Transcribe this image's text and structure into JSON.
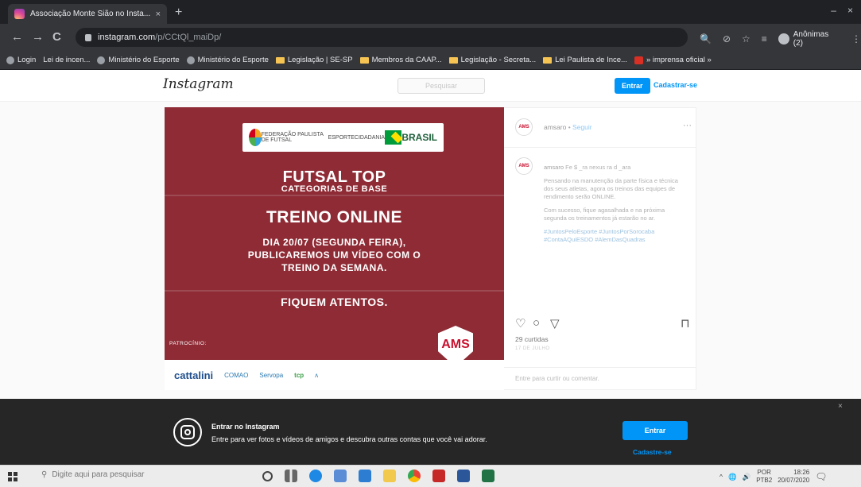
{
  "browser": {
    "tab_title": "Associação Monte Sião no Insta...",
    "tab_close": "×",
    "new_tab": "+",
    "window_controls": [
      "–",
      "×"
    ],
    "back": "←",
    "forward": "→",
    "reload": "C",
    "url_host": "instagram.com",
    "url_path": "/p/CCtQl_maiDp/",
    "toolbar_icons": [
      "🔍",
      "⊘",
      "☆",
      "≡"
    ],
    "profile_label": "Anônimas (2)",
    "menu": "⋮",
    "bookmarks": [
      {
        "icon": "globe",
        "label": "Login"
      },
      {
        "icon": "none",
        "label": "Lei de incen..."
      },
      {
        "icon": "globe",
        "label": "Ministério do Esporte"
      },
      {
        "icon": "globe",
        "label": "Ministério do Esporte"
      },
      {
        "icon": "folder",
        "label": "Legislação | SE-SP"
      },
      {
        "icon": "folder",
        "label": "Membros da CAAP..."
      },
      {
        "icon": "folder",
        "label": "Legislação - Secreta..."
      },
      {
        "icon": "folder",
        "label": "Lei Paulista de Ince..."
      },
      {
        "icon": "red",
        "label": "» imprensa oficial »"
      }
    ]
  },
  "ig_header": {
    "logo": "Instagram",
    "search_placeholder": "Pesquisar",
    "login_button": "Entrar",
    "signup_link": "Cadastrar-se"
  },
  "post": {
    "sponsor_top_left": "FEDERAÇÃO PAULISTA DE FUTSAL",
    "sponsor_top_mid1": "ESPORTE",
    "sponsor_top_mid2": "CIDADANIA",
    "sponsor_top_brand": "BRASIL",
    "title": "FUTSAL TOP",
    "subtitle": "CATEGORIAS DE BASE",
    "headline": "TREINO ONLINE",
    "body": "DIA 20/07 (SEGUNDA FEIRA), PUBLICAREMOS UM VÍDEO COM O TREINO DA SEMANA.",
    "closing": "FIQUEM ATENTOS.",
    "patrocinio": "PATROCÍNIO:",
    "badge": "AMS",
    "sponsors": [
      "cattalini",
      "COMAO",
      "Servopa",
      "tcp",
      "ʌ"
    ]
  },
  "side": {
    "avatar_text": "AMS",
    "username": "amsaro",
    "follow": "Seguir",
    "more": "···",
    "caption_user": "amsaro",
    "caption_intro": "Fe $ _ra nexus ra d _ara",
    "caption_p1": "Pensando na manutenção da parte física e técnica dos seus atletas, agora os treinos das equipes de rendimento serão ONLINE.",
    "caption_p2": "Com sucesso, fique agasalhada e na próxima segunda os treinamentos já estarão no ar.",
    "caption_tags": "#JuntosPeloEsporte #JuntosPorSorocaba #ContaAQuiESDO #AlemDasQuadras",
    "like_icon": "♡",
    "comment_icon": "○",
    "share_icon": "▽",
    "save_icon": "⊓",
    "likes": "29 curtidas",
    "date": "17 DE JULHO",
    "login_cta": "Entre para curtir ou comentar."
  },
  "banner": {
    "title": "Entrar no Instagram",
    "text": "Entre para ver fotos e vídeos de amigos e descubra outras contas que você vai adorar.",
    "login_button": "Entrar",
    "signup_link": "Cadastre-se",
    "close": "×"
  },
  "taskbar": {
    "search_placeholder": "Digite aqui para pesquisar",
    "lang_top": "POR",
    "lang_bottom": "PTB2",
    "time": "18:26",
    "date": "20/07/2020",
    "tray_icons": [
      "^",
      "🌐",
      "🔊"
    ],
    "notification": "🗨"
  },
  "colors": {
    "post_bg": "#8e2b35",
    "ig_blue": "#0095f6",
    "banner_bg": "#262626",
    "chrome_dark": "#35363a"
  }
}
